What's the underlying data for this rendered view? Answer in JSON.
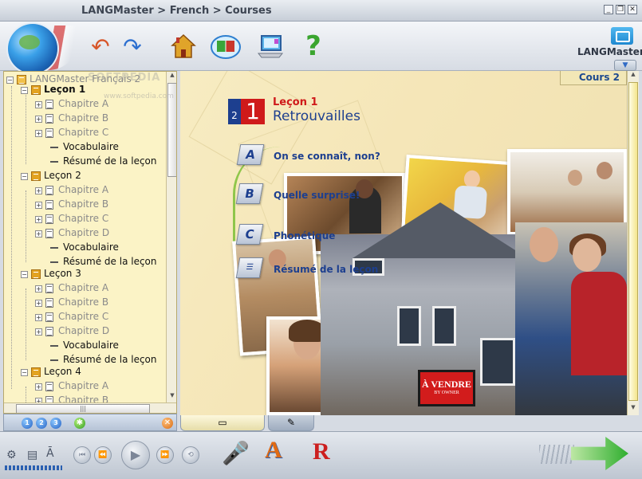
{
  "window": {
    "title": "LANGMaster > French > Courses",
    "controls": [
      "min",
      "restore",
      "close"
    ]
  },
  "toolbar": {
    "buttons": [
      "back-arrow",
      "forward-arrow",
      "home",
      "dictionary",
      "computer",
      "help"
    ],
    "help_glyph": "?",
    "logo": "LANGMaster",
    "logo_mark": "®"
  },
  "tree": {
    "root": "LANGMaster Français 2",
    "lessons": [
      {
        "label": "Leçon 1",
        "bold": true,
        "chapters": [
          "Chapitre A",
          "Chapitre B",
          "Chapitre C"
        ],
        "extras": [
          "Vocabulaire",
          "Résumé de la leçon"
        ]
      },
      {
        "label": "Leçon 2",
        "bold": false,
        "chapters": [
          "Chapitre A",
          "Chapitre B",
          "Chapitre C",
          "Chapitre D"
        ],
        "extras": [
          "Vocabulaire",
          "Résumé de la leçon"
        ]
      },
      {
        "label": "Leçon 3",
        "bold": false,
        "chapters": [
          "Chapitre A",
          "Chapitre B",
          "Chapitre C",
          "Chapitre D"
        ],
        "extras": [
          "Vocabulaire",
          "Résumé de la leçon"
        ]
      },
      {
        "label": "Leçon 4",
        "bold": false,
        "chapters": [
          "Chapitre A",
          "Chapitre B"
        ],
        "extras": []
      }
    ],
    "scroll_grip": "|||",
    "bottom_buttons": [
      "1",
      "2",
      "3"
    ],
    "star": "✱",
    "close": "✕"
  },
  "main": {
    "course_tab": "Cours 2",
    "lesson_small": "2",
    "lesson_big": "1",
    "lesson_title": "Leçon 1",
    "lesson_subtitle": "Retrouvailles",
    "sections": [
      {
        "badge": "A",
        "label": "On se connaît, non?"
      },
      {
        "badge": "B",
        "label": "Quelle surprise!"
      },
      {
        "badge": "C",
        "label": "Phonétique"
      },
      {
        "badge": "",
        "label": "Résumé de la leçon"
      }
    ],
    "sign_text": "À VENDRE",
    "sign_small": "BY OWNER"
  },
  "watermark": {
    "text": "SOFTPEDIA",
    "url": "www.softpedia.com"
  },
  "subtabs": [
    "notes-icon",
    "pencil-icon"
  ],
  "subtab_glyphs": [
    "▭",
    "✎"
  ],
  "bottombar": {
    "player_glyphs": [
      "⏮",
      "⏪",
      "▶",
      "⏩",
      "⟲"
    ]
  },
  "colors": {
    "accent_blue": "#1d3f8f",
    "accent_red": "#cf1a1a",
    "panel_yellow": "#fbf3c6"
  }
}
